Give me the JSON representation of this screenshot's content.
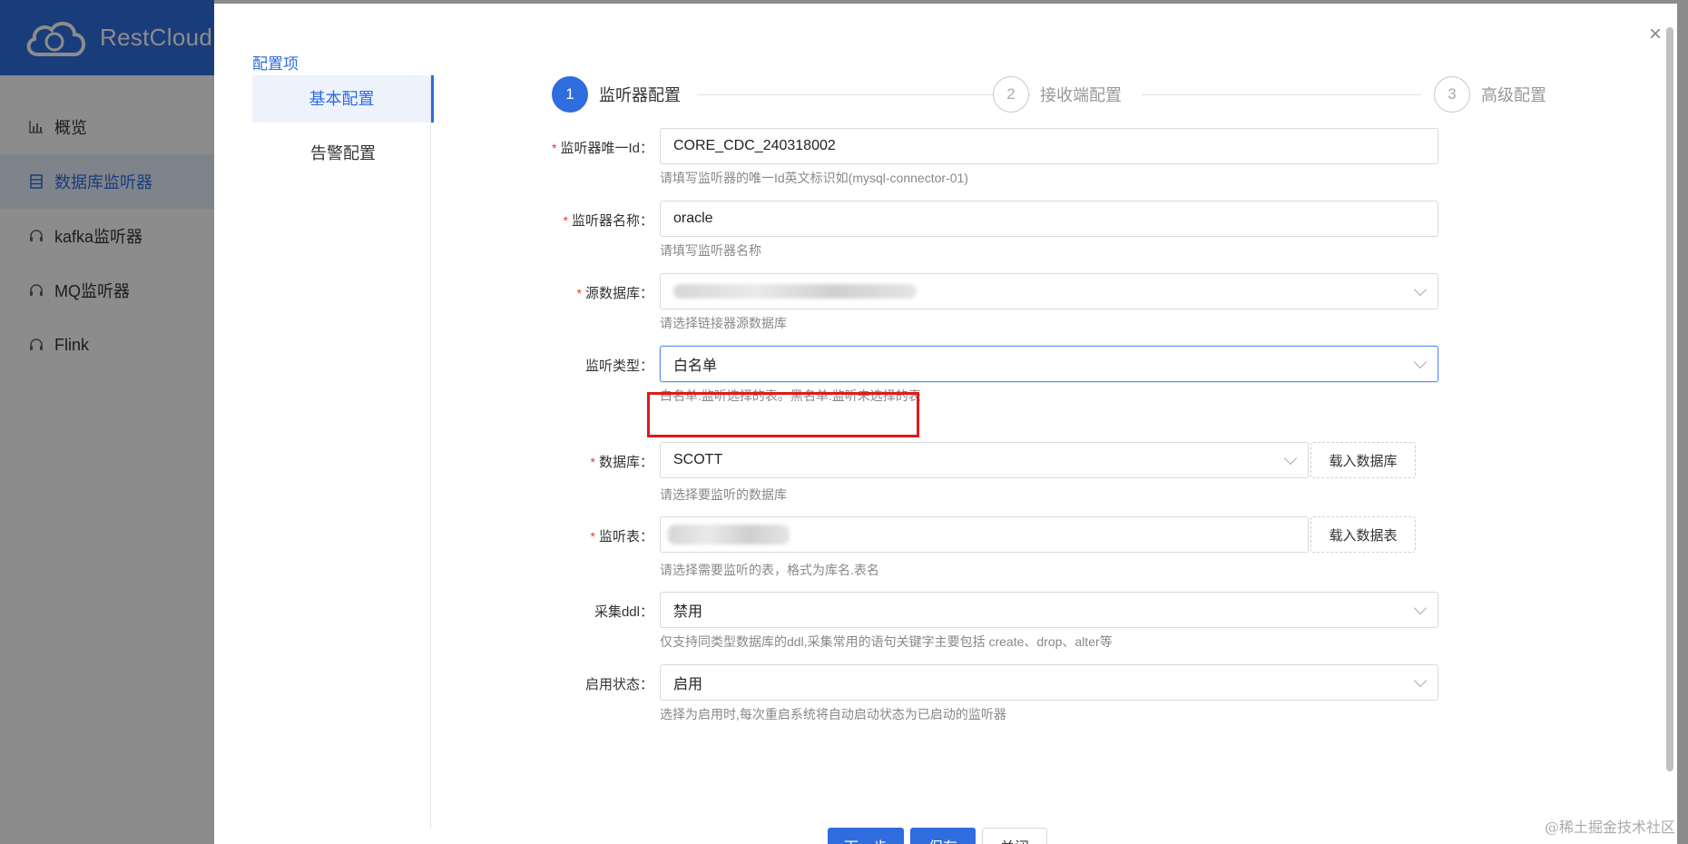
{
  "app": {
    "name": "RestCloud",
    "nav": [
      {
        "label": "概览",
        "icon": "bar-chart-icon",
        "active": false
      },
      {
        "label": "数据库监听器",
        "icon": "database-icon",
        "active": true
      },
      {
        "label": "kafka监听器",
        "icon": "headset-icon",
        "active": false
      },
      {
        "label": "MQ监听器",
        "icon": "headset-icon",
        "active": false
      },
      {
        "label": "Flink",
        "icon": "headset-icon",
        "active": false
      }
    ]
  },
  "modal": {
    "close_icon": "close-icon",
    "side": {
      "title": "配置项",
      "items": [
        {
          "label": "基本配置",
          "active": true
        },
        {
          "label": "告警配置",
          "active": false
        }
      ]
    },
    "steps": [
      {
        "number": "1",
        "label": "监听器配置",
        "active": true
      },
      {
        "number": "2",
        "label": "接收端配置",
        "active": false
      },
      {
        "number": "3",
        "label": "高级配置",
        "active": false
      }
    ],
    "form": {
      "listener_id": {
        "label": "监听器唯一Id",
        "value": "CORE_CDC_240318002",
        "hint": "请填写监听器的唯一Id英文标识如(mysql-connector-01)",
        "required": true
      },
      "listener_name": {
        "label": "监听器名称",
        "value": "oracle",
        "hint": "请填写监听器名称",
        "required": true
      },
      "source_db": {
        "label": "源数据库",
        "value": "",
        "hint": "请选择链接器源数据库",
        "required": true
      },
      "listen_type": {
        "label": "监听类型",
        "value": "白名单",
        "hint": "白名单:监听选择的表。黑名单:监听未选择的表",
        "required": false
      },
      "database": {
        "label": "数据库",
        "value": "SCOTT",
        "hint": "请选择要监听的数据库",
        "required": true,
        "button": "载入数据库"
      },
      "listen_table": {
        "label": "监听表",
        "value": "",
        "hint": "请选择需要监听的表，格式为库名.表名",
        "required": true,
        "button": "载入数据表"
      },
      "collect_ddl": {
        "label": "采集ddl",
        "value": "禁用",
        "hint": "仅支持同类型数据库的ddl,采集常用的语句关键字主要包括 create、drop、alter等",
        "required": false
      },
      "enable_status": {
        "label": "启用状态",
        "value": "启用",
        "hint": "选择为启用时,每次重启系统将自动启动状态为已启动的监听器",
        "required": false
      }
    },
    "buttons": {
      "next": "下一步",
      "save": "保存",
      "close": "关闭"
    }
  },
  "watermark": "@稀土掘金技术社区",
  "colors": {
    "primary": "#2f6dde",
    "required": "#e53935",
    "highlight": "#e0191b"
  }
}
